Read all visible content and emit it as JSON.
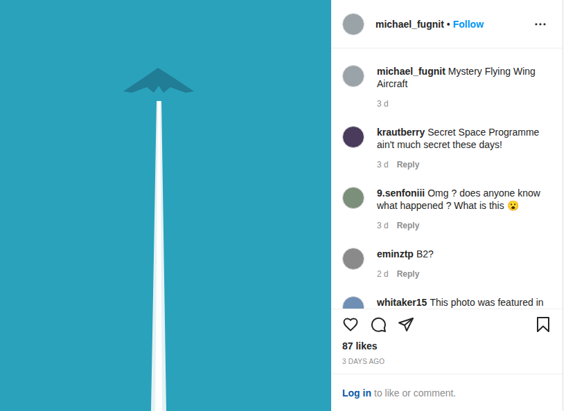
{
  "post": {
    "username": "michael_fugnit",
    "separator": "•",
    "follow": "Follow"
  },
  "comments": [
    {
      "kind": "caption",
      "username": "michael_fugnit",
      "text": "Mystery Flying Wing Aircraft",
      "time": "3 d"
    },
    {
      "kind": "comment",
      "username": "krautberry",
      "text": "Secret Space Programme ain't much secret these days!",
      "time": "3 d",
      "reply": "Reply"
    },
    {
      "kind": "comment",
      "username": "9.senfoniii",
      "text": "Omg ? does anyone know what happened ? What is this 😮",
      "time": "3 d",
      "reply": "Reply"
    },
    {
      "kind": "comment",
      "username": "eminztp",
      "text": "B2?",
      "time": "2 d",
      "reply": "Reply"
    },
    {
      "kind": "cut",
      "username": "whitaker15",
      "text": "This photo was featured in"
    }
  ],
  "actions": {
    "liked": false,
    "saved": false
  },
  "likes": "87 likes",
  "date": "3 DAYS AGO",
  "login": {
    "link": "Log in",
    "text": "to like or comment."
  }
}
